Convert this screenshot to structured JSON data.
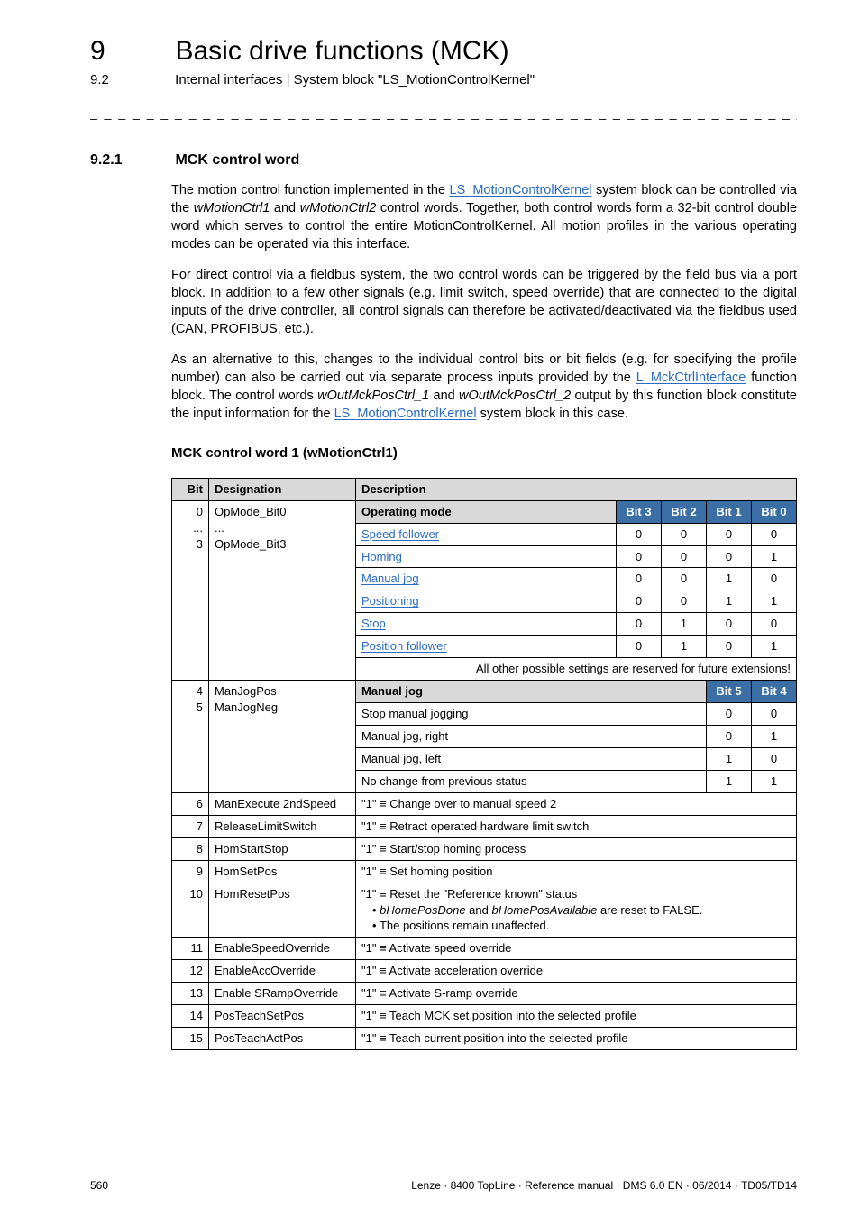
{
  "chapter": {
    "num": "9",
    "title": "Basic drive functions (MCK)"
  },
  "subhead": {
    "num": "9.2",
    "title": "Internal interfaces | System block \"LS_MotionControlKernel\""
  },
  "dashes": "_ _ _ _ _ _ _ _ _ _ _ _ _ _ _ _ _ _ _ _ _ _ _ _ _ _ _ _ _ _ _ _ _ _ _ _ _ _ _ _ _ _ _ _ _ _ _ _ _ _ _ _ _ _ _ _ _ _ _ _ _ _ _ _",
  "section": {
    "num": "9.2.1",
    "title": "MCK control word"
  },
  "body": {
    "p1a": "The motion control function implemented in the ",
    "p1link": "LS_MotionControlKernel",
    "p1b": " system block can be controlled via the ",
    "p1iw1": "wMotionCtrl1",
    "p1c": " and ",
    "p1iw2": "wMotionCtrl2",
    "p1d": " control words. Together, both control words form a 32-bit control double word which serves to control the entire MotionControlKernel. All motion profiles in the various operating modes can be operated via this interface.",
    "p2": "For direct control via a fieldbus system, the two control words can be triggered by the field bus via a port block. In addition to a few other signals (e.g. limit switch, speed override) that are connected to the digital inputs of the drive controller, all control signals can therefore be activated/deactivated via the fieldbus used (CAN, PROFIBUS, etc.).",
    "p3a": "As an alternative to this, changes to the individual control bits or bit fields (e.g. for specifying the profile number) can also be carried out via separate process inputs provided by the ",
    "p3link1": "L_MckCtrlInterface",
    "p3b": " function block. The control words ",
    "p3i1": "wOutMckPosCtrl_1",
    "p3c": " and ",
    "p3i2": "wOutMckPosCtrl_2",
    "p3d": " output by this function block constitute the input information for the ",
    "p3link2": "LS_MotionControlKernel",
    "p3e": " system block in this case.",
    "subhead": "MCK control word 1 (wMotionCtrl1)"
  },
  "table": {
    "headers": {
      "bit": "Bit",
      "des": "Designation",
      "desc": "Description"
    },
    "bithead": {
      "b3": "Bit 3",
      "b2": "Bit 2",
      "b1": "Bit 1",
      "b0": "Bit 0",
      "b5": "Bit 5",
      "b4": "Bit 4"
    },
    "des": {
      "r0a": "OpMode_Bit0",
      "r0b": "...",
      "r0c": "OpMode_Bit3",
      "r4a": "ManJogPos",
      "r4b": "ManJogNeg",
      "r6": "ManExecute 2ndSpeed",
      "r7": "ReleaseLimitSwitch",
      "r8": "HomStartStop",
      "r9": "HomSetPos",
      "r10": "HomResetPos",
      "r11": "EnableSpeedOverride",
      "r12": "EnableAccOverride",
      "r13": "Enable SRampOverride",
      "r14": "PosTeachSetPos",
      "r15": "PosTeachActPos"
    },
    "opmode": {
      "title": "Operating mode",
      "rows": [
        {
          "name": "Speed follower",
          "b3": "0",
          "b2": "0",
          "b1": "0",
          "b0": "0"
        },
        {
          "name": "Homing",
          "b3": "0",
          "b2": "0",
          "b1": "0",
          "b0": "1"
        },
        {
          "name": "Manual jog",
          "b3": "0",
          "b2": "0",
          "b1": "1",
          "b0": "0"
        },
        {
          "name": "Positioning",
          "b3": "0",
          "b2": "0",
          "b1": "1",
          "b0": "1"
        },
        {
          "name": "Stop",
          "b3": "0",
          "b2": "1",
          "b1": "0",
          "b0": "0"
        },
        {
          "name": "Position follower",
          "b3": "0",
          "b2": "1",
          "b1": "0",
          "b0": "1"
        }
      ],
      "note": "All other possible settings are reserved for future extensions!"
    },
    "manjog": {
      "title": "Manual jog",
      "rows": [
        {
          "name": "Stop manual jogging",
          "b5": "0",
          "b4": "0"
        },
        {
          "name": "Manual jog, right",
          "b5": "0",
          "b4": "1"
        },
        {
          "name": "Manual jog, left",
          "b5": "1",
          "b4": "0"
        },
        {
          "name": "No change from previous status",
          "b5": "1",
          "b4": "1"
        }
      ]
    },
    "desc": {
      "r6": "\"1\" ≡ Change over to manual speed 2",
      "r7": "\"1\" ≡ Retract operated hardware limit switch",
      "r8": "\"1\" ≡ Start/stop homing process",
      "r9": "\"1\" ≡ Set homing position",
      "r10a": "\"1\" ≡ Reset the \"Reference known\" status",
      "r10b1": "bHomePosDone",
      "r10b2": " and ",
      "r10b3": "bHomePosAvailable",
      "r10b4": " are reset to FALSE.",
      "r10c": "The positions remain unaffected.",
      "r11": "\"1\" ≡ Activate speed override",
      "r12": "\"1\" ≡ Activate acceleration override",
      "r13": "\"1\" ≡ Activate S-ramp override",
      "r14": "\"1\" ≡ Teach MCK set position into the selected profile",
      "r15": "\"1\" ≡ Teach current position into the selected profile"
    },
    "bits": {
      "r0": "0",
      "rdots": "...",
      "r3": "3",
      "r4": "4",
      "r5": "5",
      "r6": "6",
      "r7": "7",
      "r8": "8",
      "r9": "9",
      "r10": "10",
      "r11": "11",
      "r12": "12",
      "r13": "13",
      "r14": "14",
      "r15": "15"
    }
  },
  "footer": {
    "page": "560",
    "right": "Lenze · 8400 TopLine · Reference manual · DMS 6.0 EN · 06/2014 · TD05/TD14"
  }
}
